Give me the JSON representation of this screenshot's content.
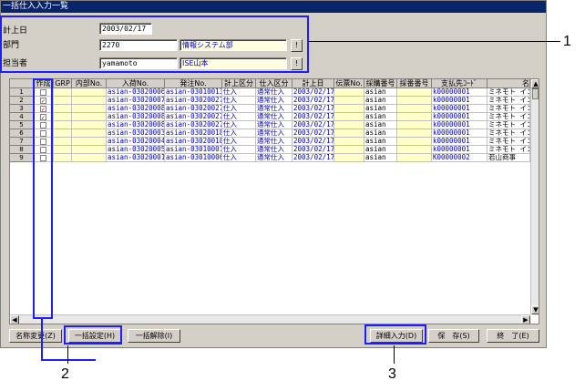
{
  "window": {
    "title": "一括仕入入力一覧"
  },
  "form": {
    "date_label": "計上日",
    "date_value": "2003/02/17",
    "dept_label": "部門",
    "dept_code": "2270",
    "dept_name": "情報システム部",
    "person_label": "担当者",
    "person_code": "yamamoto",
    "person_name": "ISE山本",
    "lookup_label": "!"
  },
  "grid": {
    "columns": [
      "作成",
      "GRP",
      "内部No.",
      "入荷No.",
      "発注No.",
      "計上区分",
      "仕入区分",
      "計上日",
      "伝票No.",
      "採購番号",
      "採番番号",
      "支払先ｺｰﾄﾞ",
      "名"
    ],
    "rows": [
      {
        "num": "1",
        "checked": false,
        "grp": "",
        "nyuka": "asian-03020006",
        "hachu": "asian-03010013",
        "keijo_kbn": "仕入",
        "shiire_kbn": "通常仕入",
        "date": "2003/02/17",
        "denpyo": "",
        "saiko": "asian",
        "saiban": "",
        "shiharai": "k00000001",
        "name": "ミネモト イン"
      },
      {
        "num": "2",
        "checked": true,
        "grp": "",
        "nyuka": "asian-03020007",
        "hachu": "asian-03020027",
        "keijo_kbn": "仕入",
        "shiire_kbn": "通常仕入",
        "date": "2003/02/17",
        "denpyo": "",
        "saiko": "asian",
        "saiban": "",
        "shiharai": "k00000001",
        "name": "ミネモト イン"
      },
      {
        "num": "3",
        "checked": true,
        "grp": "",
        "nyuka": "asian-03020008",
        "hachu": "asian-03020027",
        "keijo_kbn": "仕入",
        "shiire_kbn": "通常仕入",
        "date": "2003/02/17",
        "denpyo": "",
        "saiko": "asian",
        "saiban": "",
        "shiharai": "k00000001",
        "name": "ミネモト イン"
      },
      {
        "num": "4",
        "checked": true,
        "grp": "",
        "nyuka": "asian-03020008",
        "hachu": "asian-03020027",
        "keijo_kbn": "仕入",
        "shiire_kbn": "通常仕入",
        "date": "2003/02/17",
        "denpyo": "",
        "saiko": "asian",
        "saiban": "",
        "shiharai": "k00000001",
        "name": "ミネモト イン"
      },
      {
        "num": "5",
        "checked": false,
        "grp": "",
        "nyuka": "asian-03020008",
        "hachu": "asian-03020027",
        "keijo_kbn": "仕入",
        "shiire_kbn": "通常仕入",
        "date": "2003/02/17",
        "denpyo": "",
        "saiko": "asian",
        "saiban": "",
        "shiharai": "k00000001",
        "name": "ミネモト イン"
      },
      {
        "num": "6",
        "checked": false,
        "grp": "",
        "nyuka": "asian-03020003",
        "hachu": "asian-03020018",
        "keijo_kbn": "仕入",
        "shiire_kbn": "通常仕入",
        "date": "2003/02/17",
        "denpyo": "",
        "saiko": "asian",
        "saiban": "",
        "shiharai": "k00000001",
        "name": "ミネモト イン"
      },
      {
        "num": "7",
        "checked": false,
        "grp": "",
        "nyuka": "asian-03020004",
        "hachu": "asian-03020018",
        "keijo_kbn": "仕入",
        "shiire_kbn": "通常仕入",
        "date": "2003/02/17",
        "denpyo": "",
        "saiko": "asian",
        "saiban": "",
        "shiharai": "k00000001",
        "name": "ミネモト イン"
      },
      {
        "num": "8",
        "checked": false,
        "grp": "",
        "nyuka": "asian-03020005",
        "hachu": "asian-03010001",
        "keijo_kbn": "仕入",
        "shiire_kbn": "通常仕入",
        "date": "2003/02/17",
        "denpyo": "",
        "saiko": "asian",
        "saiban": "",
        "shiharai": "k00000001",
        "name": "ミネモト イン"
      },
      {
        "num": "9",
        "checked": false,
        "grp": "",
        "nyuka": "asian-03020001",
        "hachu": "asian-03010006",
        "keijo_kbn": "仕入",
        "shiire_kbn": "通常仕入",
        "date": "2003/02/17",
        "denpyo": "",
        "saiko": "asian",
        "saiban": "",
        "shiharai": "K00000002",
        "name": "若山商事"
      }
    ]
  },
  "buttons": {
    "rename": "名称変更(Z)",
    "bulk_set": "一括設定(H)",
    "bulk_clear": "一括解除(I)",
    "detail_input": "詳細入力(D)",
    "save": "保　存(S)",
    "exit": "終　了(E)"
  },
  "callouts": {
    "c1": "1",
    "c2": "2",
    "c3": "3"
  },
  "colors": {
    "title_bar": "#0a246a",
    "highlight_box": "#1d1dff",
    "readonly_field": "#ffffe0"
  }
}
